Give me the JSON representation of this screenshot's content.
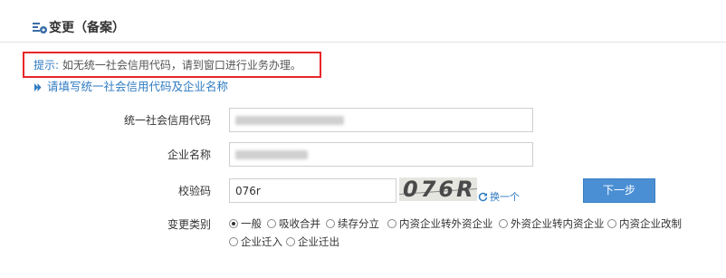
{
  "header": {
    "title": "变更（备案）",
    "icon": "form-edit-icon"
  },
  "notice": {
    "prefix": "提示:",
    "text": " 如无统一社会信用代码，请到窗口进行业务办理。",
    "border_color": "#e8262a"
  },
  "section": {
    "heading": "请填写统一社会信用代码及企业名称"
  },
  "form": {
    "credit_code_label": "统一社会信用代码",
    "company_name_label": "企业名称",
    "captcha_label": "校验码",
    "captcha_value": "076r",
    "captcha_image_text": "076R",
    "refresh_label": "换一个",
    "next_label": "下一步",
    "change_type_label": "变更类别"
  },
  "change_types": [
    {
      "label": "一般",
      "checked": true
    },
    {
      "label": "吸收合并",
      "checked": false
    },
    {
      "label": "续存分立",
      "checked": false
    },
    {
      "label": "内资企业转外资企业",
      "checked": false
    },
    {
      "label": "外资企业转内资企业",
      "checked": false
    },
    {
      "label": "内资企业改制",
      "checked": false
    },
    {
      "label": "企业迁入",
      "checked": false
    },
    {
      "label": "企业迁出",
      "checked": false
    }
  ],
  "colors": {
    "accent": "#2f7bc2",
    "button": "#4a8fd4",
    "alert": "#e8262a"
  }
}
